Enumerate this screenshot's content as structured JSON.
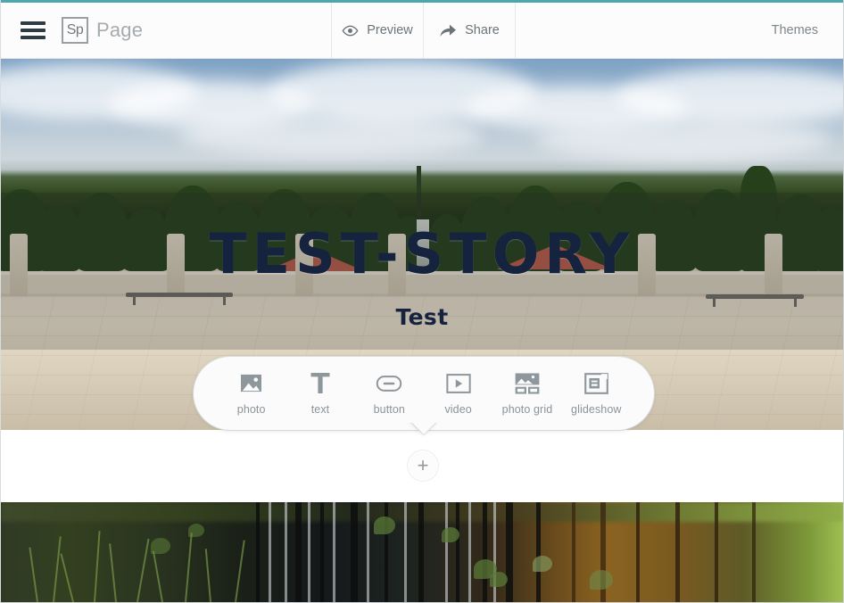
{
  "app": {
    "accent_color": "#4ea8ab",
    "logo_badge": "Sp",
    "logo_word": "Page"
  },
  "topbar": {
    "menu_icon": "hamburger-menu-icon",
    "buttons": [
      {
        "label": "Preview",
        "icon": "eye-icon"
      },
      {
        "label": "Share",
        "icon": "share-arrow-icon"
      }
    ],
    "themes_label": "Themes"
  },
  "hero": {
    "title": "TEST-STORY",
    "subtitle": "Test",
    "title_color": "#15233f",
    "background_image": "palace-garden-terrace-photo"
  },
  "insert_menu": {
    "items": [
      {
        "label": "photo",
        "icon": "photo-icon"
      },
      {
        "label": "text",
        "icon": "text-t-icon"
      },
      {
        "label": "button",
        "icon": "button-pill-icon"
      },
      {
        "label": "video",
        "icon": "video-play-icon"
      },
      {
        "label": "photo grid",
        "icon": "photo-grid-icon"
      },
      {
        "label": "glideshow",
        "icon": "glideshow-icon"
      }
    ],
    "add_button_label": "+"
  },
  "section2": {
    "background_image": "forest-water-reflection-photo"
  }
}
